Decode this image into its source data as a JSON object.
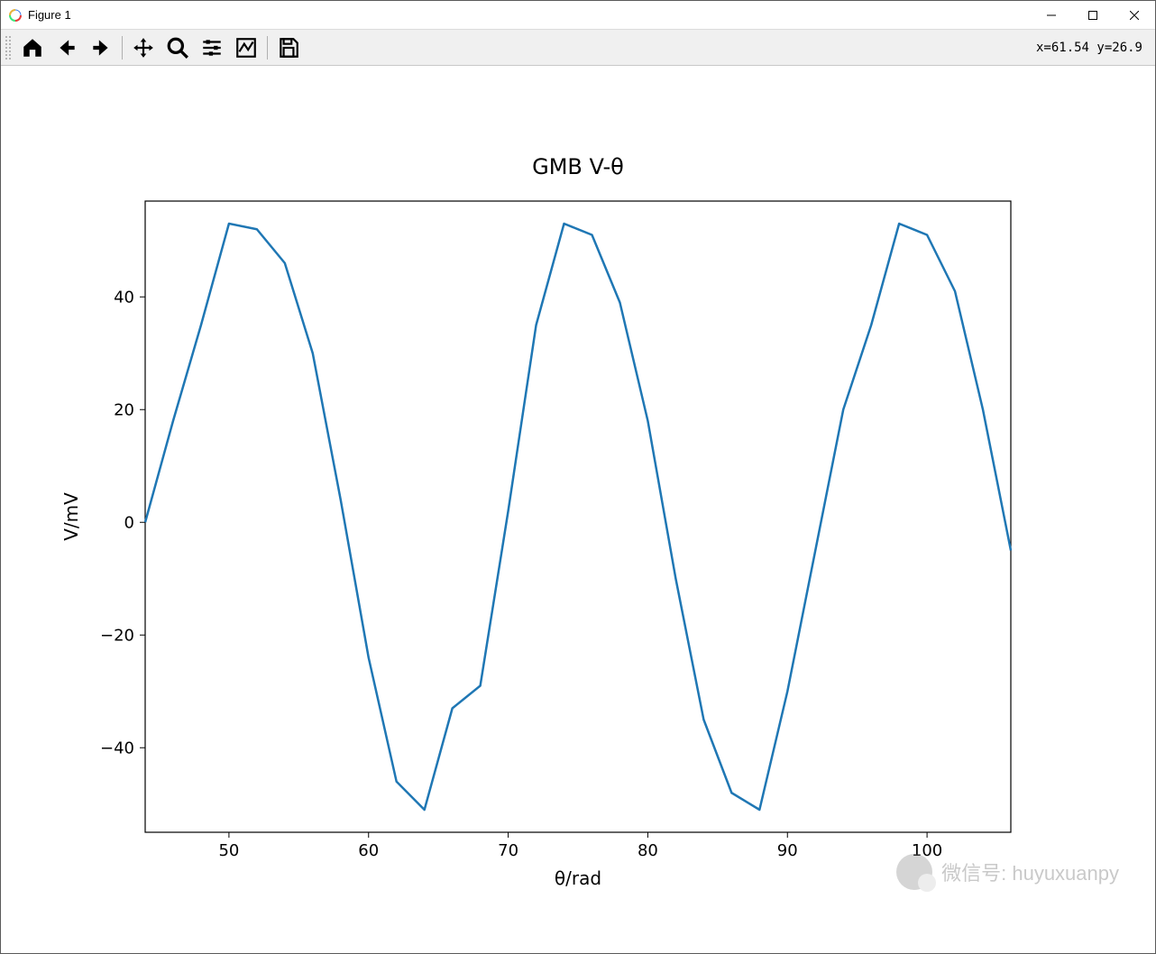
{
  "window": {
    "title": "Figure 1"
  },
  "toolbar": {
    "coord_readout": "x=61.54 y=26.9"
  },
  "watermark": {
    "text": "微信号: huyuxuanpy"
  },
  "chart_data": {
    "type": "line",
    "title": "GMB V-θ",
    "xlabel": "θ/rad",
    "ylabel": "V/mV",
    "xlim": [
      44,
      106
    ],
    "ylim": [
      -55,
      57
    ],
    "xticks": [
      50,
      60,
      70,
      80,
      90,
      100
    ],
    "yticks": [
      -40,
      -20,
      0,
      20,
      40
    ],
    "series": [
      {
        "name": "V",
        "color": "#1f77b4",
        "x": [
          44,
          46,
          48,
          50,
          52,
          54,
          56,
          58,
          60,
          62,
          64,
          66,
          68,
          70,
          72,
          74,
          76,
          78,
          80,
          82,
          84,
          86,
          88,
          90,
          92,
          94,
          96,
          98,
          100,
          102,
          104,
          106
        ],
        "y": [
          0,
          18,
          35,
          53,
          52,
          46,
          30,
          4,
          -24,
          -46,
          -51,
          -33,
          -29,
          2,
          35,
          53,
          51,
          39,
          18,
          -10,
          -35,
          -48,
          -51,
          -30,
          -5,
          20,
          35,
          53,
          51,
          41,
          20,
          -5
        ]
      }
    ]
  }
}
